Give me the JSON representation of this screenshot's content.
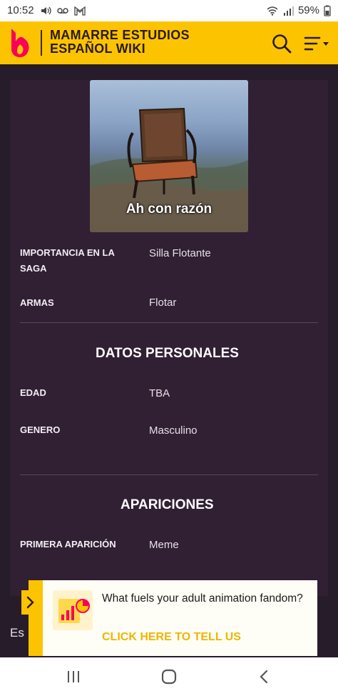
{
  "status_bar": {
    "time": "10:52",
    "battery": "59%",
    "left_icons": [
      "volume-icon",
      "voicemail-icon",
      "gmail-icon"
    ],
    "right_icons": [
      "wifi-icon",
      "signal-icon"
    ]
  },
  "header": {
    "title_line1": "MAMARRE ESTUDIOS",
    "title_line2": "ESPAÑOL WIKI",
    "accent_color": "#fcc400",
    "logo_icon": "fandom-flame-icon",
    "search_icon": "search-icon",
    "menu_icon": "menu-lines-icon"
  },
  "infobox": {
    "image_caption": "Ah con razón",
    "fields": [
      {
        "label_line1": "IMPORTANCIA EN LA",
        "label_line2": "SAGA",
        "value": "Silla Flotante"
      },
      {
        "label": "ARMAS",
        "value": "Flotar"
      }
    ],
    "sections": [
      {
        "title": "DATOS PERSONALES",
        "fields": [
          {
            "label": "EDAD",
            "value": "TBA"
          },
          {
            "label": "GENERO",
            "value": "Masculino"
          }
        ]
      },
      {
        "title": "APARICIONES",
        "fields": [
          {
            "label": "PRIMERA APARICIÓN",
            "value": "Meme"
          }
        ]
      }
    ]
  },
  "article": {
    "partial_text": "Es"
  },
  "ad": {
    "question": "What fuels your adult animation fandom?",
    "cta": "CLICK HERE TO TELL US",
    "cta_color": "#f0b400"
  },
  "nav_bar": {
    "icons": [
      "recent-apps-icon",
      "home-icon",
      "back-icon"
    ]
  }
}
